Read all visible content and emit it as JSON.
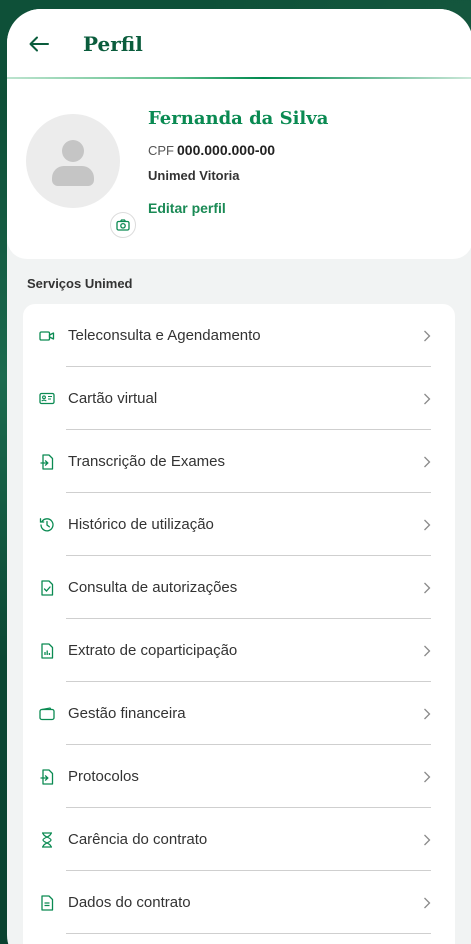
{
  "header": {
    "title": "Perfil"
  },
  "profile": {
    "name": "Fernanda da Silva",
    "cpf_label": "CPF",
    "cpf_value": "000.000.000-00",
    "unit": "Unimed Vitoria",
    "edit_label": "Editar perfil"
  },
  "services": {
    "title": "Serviços Unimed",
    "items": [
      {
        "label": "Teleconsulta e Agendamento",
        "icon": "video-camera-icon"
      },
      {
        "label": "Cartão virtual",
        "icon": "id-card-icon"
      },
      {
        "label": "Transcrição de Exames",
        "icon": "document-transfer-icon"
      },
      {
        "label": "Histórico de utilização",
        "icon": "history-icon"
      },
      {
        "label": "Consulta de autorizações",
        "icon": "document-check-icon"
      },
      {
        "label": "Extrato de coparticipação",
        "icon": "document-chart-icon"
      },
      {
        "label": "Gestão financeira",
        "icon": "wallet-icon"
      },
      {
        "label": "Protocolos",
        "icon": "document-transfer-icon"
      },
      {
        "label": "Carência do contrato",
        "icon": "hourglass-icon"
      },
      {
        "label": "Dados do contrato",
        "icon": "document-text-icon"
      }
    ]
  },
  "colors": {
    "brand_green": "#0a8a52",
    "dark_green": "#0a5c3c",
    "background": "#0c4a35"
  }
}
